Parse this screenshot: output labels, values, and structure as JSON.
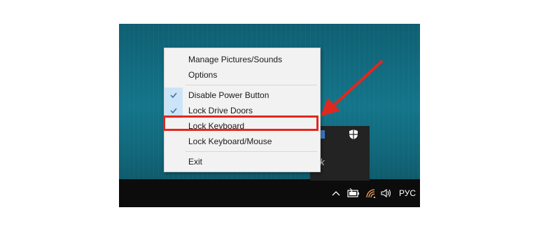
{
  "menu": {
    "items": [
      {
        "label": "Manage Pictures/Sounds",
        "checked": false
      },
      {
        "label": "Options",
        "checked": false
      },
      {
        "label": "Disable Power Button",
        "checked": true
      },
      {
        "label": "Lock Drive Doors",
        "checked": true
      },
      {
        "label": "Lock Keyboard",
        "checked": false,
        "highlighted": true
      },
      {
        "label": "Lock Keyboard/Mouse",
        "checked": false
      },
      {
        "label": "Exit",
        "checked": false
      }
    ]
  },
  "tray": {
    "language": "РУС",
    "icons": [
      "chevron-up-icon",
      "battery-icon",
      "wifi-icon",
      "speaker-icon"
    ],
    "panel_icons": [
      "shield-icon",
      "tray-badge-icon"
    ],
    "panel_glyph": "k"
  },
  "colors": {
    "desktop": "#14758a",
    "taskbar": "#0c0c0c",
    "menu_bg": "#f2f2f2",
    "check_bg": "#cce4f7",
    "highlight": "#e0281e",
    "arrow": "#e0281e"
  }
}
